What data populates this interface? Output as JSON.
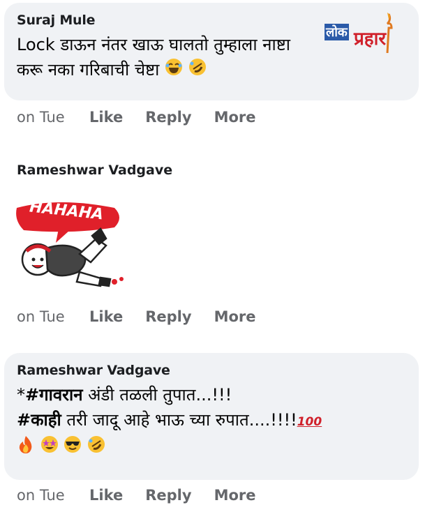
{
  "comments": [
    {
      "author": "Suraj Mule",
      "line1": "Lock डाऊन नंतर खाऊ घालतो तुम्हाला नाष्टा",
      "line2": "करू नका गरिबाची चेष्टा",
      "emojis": [
        "laughing-face-icon",
        "rolling-laughing-face-icon"
      ],
      "time": "on Tue",
      "actions": [
        "Like",
        "Reply",
        "More"
      ],
      "watermark": {
        "text_a": "लोक",
        "text_b": "प्रहार",
        "color_a": "#2a5aa8",
        "color_b": "#d0202a"
      }
    },
    {
      "author": "Rameshwar Vadgave",
      "sticker_text": "HAHAHA",
      "time": "on Tue",
      "actions": [
        "Like",
        "Reply",
        "More"
      ]
    },
    {
      "author": "Rameshwar Vadgave",
      "line1_prefix": "*",
      "line1_tag": "#गावरान",
      "line1_rest": " अंडी तळली तुपात...!!!",
      "line2_tag": "#काही",
      "line2_rest": " तरी जादू आहे भाऊ च्या रुपात....!!!!",
      "hundred": "100",
      "emojis": [
        "fire-icon",
        "star-struck-icon",
        "sunglasses-face-icon",
        "rolling-laughing-face-icon"
      ],
      "time": "on Tue",
      "actions": [
        "Like",
        "Reply",
        "More"
      ]
    }
  ],
  "colors": {
    "bubble": "#f0f2f5",
    "meta": "#65676b",
    "sticker_red": "#e0202a",
    "emoji_yellow": "#f9c132"
  }
}
